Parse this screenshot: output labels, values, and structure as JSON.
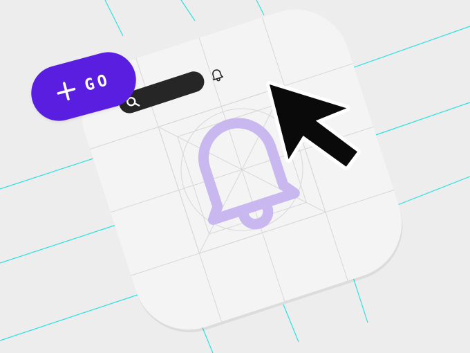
{
  "colors": {
    "background": "#ededed",
    "guide_line": "#2de0e0",
    "card": "#f4f4f4",
    "grid_line": "#d7d7d7",
    "search_bar": "#262626",
    "bell_accent": "#c9b8f0",
    "go_button": "#5a1ee0",
    "cursor_fill": "#0a0a0a",
    "cursor_outline": "#ffffff"
  },
  "icons": {
    "search": "search-icon",
    "notification": "bell-icon",
    "large_bell": "bell-icon",
    "add": "plus-icon",
    "pointer": "arrow-cursor-icon"
  },
  "go_button": {
    "label": "GO"
  }
}
